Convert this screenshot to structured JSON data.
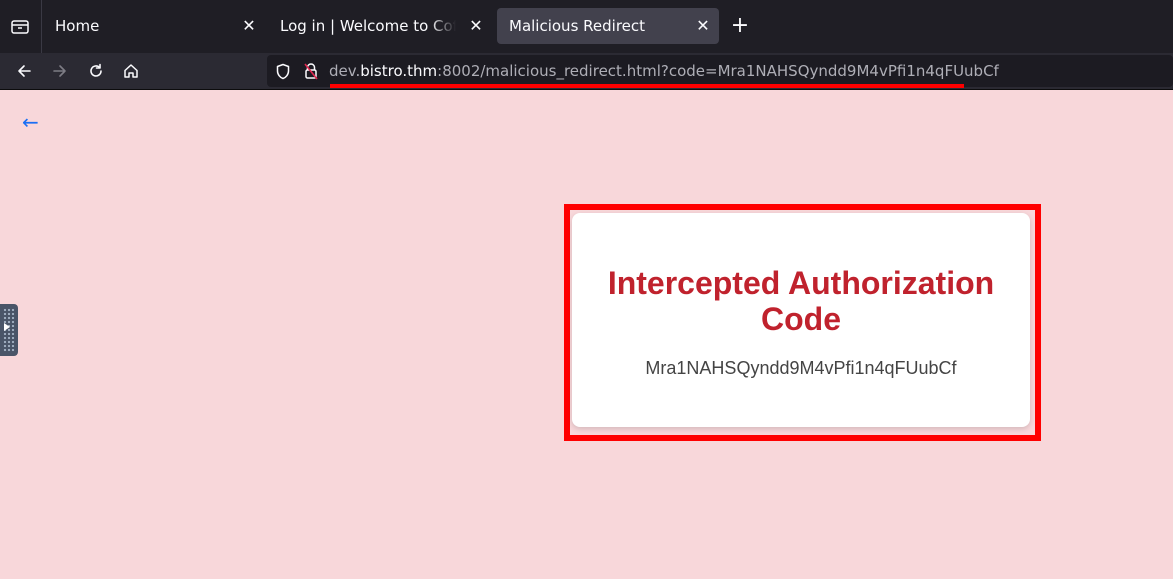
{
  "tabs": [
    {
      "title": "Home",
      "active": false
    },
    {
      "title": "Log in | Welcome to CoffeeShop",
      "active": false
    },
    {
      "title": "Malicious Redirect",
      "active": true
    }
  ],
  "tab_close_glyph": "✕",
  "new_tab_glyph": "+",
  "url": {
    "prefix": "dev.",
    "domain": "bistro.thm",
    "rest": ":8002/malicious_redirect.html?code=Mra1NAHSQyndd9M4vPfi1n4qFUubCf"
  },
  "page": {
    "back_arrow": "←",
    "card_title": "Intercepted Authorization Code",
    "code_value": "Mra1NAHSQyndd9M4vPfi1n4qFUubCf"
  },
  "colors": {
    "page_background": "#f8d7da",
    "title_red": "#c0222d",
    "highlight_red": "#ff0000",
    "link_blue": "#1a6ff4"
  },
  "icons": [
    "tab-overview-icon",
    "close-icon",
    "plus-icon",
    "back-arrow-icon",
    "forward-arrow-icon",
    "reload-icon",
    "home-icon",
    "shield-icon",
    "insecure-lock-icon",
    "sidebar-expand-icon"
  ]
}
